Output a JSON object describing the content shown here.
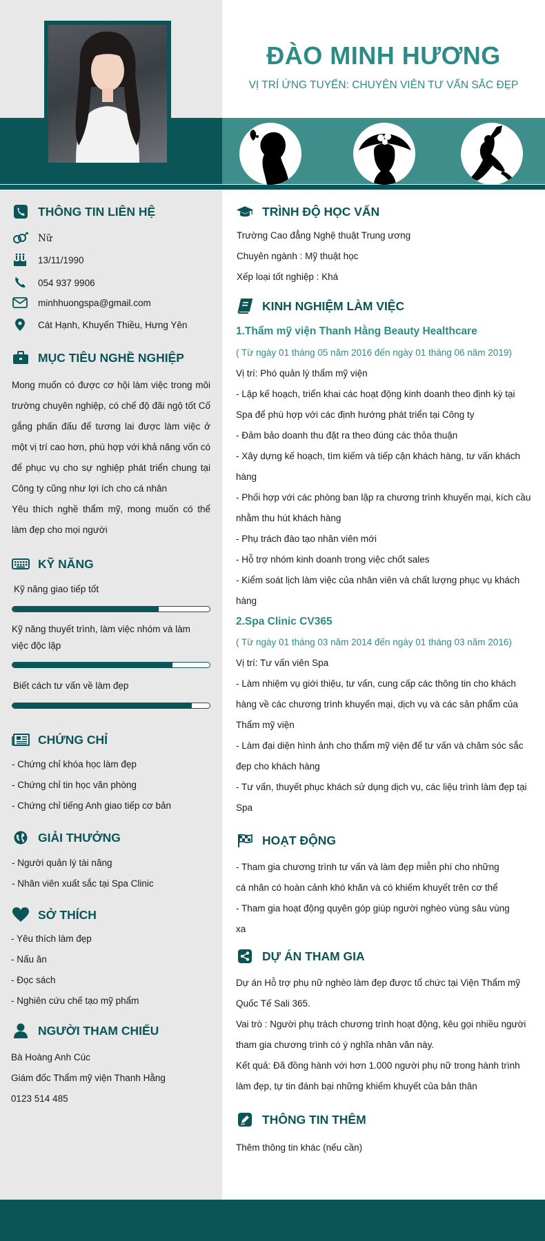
{
  "header": {
    "name": "ĐÀO MINH HƯƠNG",
    "position": "VỊ TRÍ ỨNG TUYỂN: CHUYÊN VIÊN TƯ VẤN SẮC ĐẸP"
  },
  "colors": {
    "primary": "#0b5457",
    "accent": "#2d8b87",
    "band": "#3e8f8c",
    "sidebar": "#e8e8e8"
  },
  "contact": {
    "title": "THÔNG TIN LIÊN HỆ",
    "gender": "Nữ",
    "birthday": "13/11/1990",
    "phone": "054 937 9906",
    "email": "minhhuongspa@gmail.com",
    "address": "Cát Hạnh, Khuyến Thiều, Hưng Yên"
  },
  "objective": {
    "title": "MỤC TIÊU NGHỀ NGHIỆP",
    "text1": "Mong muốn có được cơ hội làm việc trong môi trường chuyên nghiệp, có chế độ đãi ngộ tốt Cố gắng phấn đấu để tương lai được làm việc ở một vị trí cao hơn, phù hợp với khả năng vốn có để phục vụ cho sự nghiệp phát triển chung tại Công ty cũng như lợi ích cho cá nhân",
    "text2": "Yêu thích nghề thẩm mỹ, mong muốn có thể làm đẹp cho mọi người"
  },
  "skills": {
    "title": "KỸ NĂNG",
    "items": [
      {
        "label": "Kỹ năng giao tiếp tốt",
        "level": 0.74
      },
      {
        "label": "Kỹ năng thuyết trình, làm việc nhóm và làm việc độc lập",
        "level": 0.81
      },
      {
        "label": "Biết cách tư vấn về làm đẹp",
        "level": 0.91
      }
    ]
  },
  "certificates": {
    "title": "CHỨNG CHỈ",
    "items": [
      "- Chứng chỉ khóa học làm đẹp",
      "- Chứng chỉ tin học văn phòng",
      "- Chứng chỉ tiếng Anh giao tiếp cơ bản"
    ]
  },
  "awards": {
    "title": "GIẢI THƯỞNG",
    "items": [
      "- Người quản lý tài năng",
      "- Nhân viên xuất sắc tại Spa Clinic"
    ]
  },
  "hobbies": {
    "title": "SỞ THÍCH",
    "items": [
      "- Yêu thích làm đẹp",
      "- Nấu ăn",
      "- Đọc sách",
      "- Nghiên cứu chế tạo mỹ phẩm"
    ]
  },
  "references": {
    "title": "NGƯỜI THAM CHIẾU",
    "items": [
      "Bà Hoàng Anh Cúc",
      "Giám đốc Thẩm mỹ viện Thanh Hằng",
      "0123 514 485"
    ]
  },
  "education": {
    "title": "TRÌNH ĐỘ HỌC VẤN",
    "items": [
      "Trường Cao đẳng Nghệ thuật Trung ương",
      "Chuyên ngành : Mỹ thuật học",
      "Xếp loại tốt nghiệp : Khá"
    ]
  },
  "experience": {
    "title": "KINH NGHIỆM LÀM VIỆC",
    "jobs": [
      {
        "company": "1.Thẩm mỹ viện Thanh Hằng Beauty Healthcare",
        "date": "( Từ ngày 01 tháng 05 năm 2016  đến ngày 01 tháng 06 năm 2019)",
        "role": "Vị trí: Phó quản lý thẩm mỹ viện",
        "duties": [
          "- Lập kế hoạch, triển khai các hoạt động kinh doanh theo định kỳ tại Spa để phù hợp với các định hướng phát triển tại Công ty",
          "- Đảm bảo doanh thu đặt ra theo đúng các thỏa thuận",
          "- Xây dựng kế hoạch, tìm kiếm và tiếp cận khách hàng, tư vấn khách hàng",
          "- Phối hợp với các phòng ban lập ra chương trình khuyến mại, kích cầu nhằm thu hút khách hàng",
          "- Phụ trách đào tạo nhân viên mới",
          "- Hỗ trợ nhóm kinh doanh trong việc chốt sales",
          "- Kiểm soát lịch làm việc của nhân viên và chất lượng phục vụ khách hàng"
        ]
      },
      {
        "company": "2.Spa Clinic CV365",
        "date": "( Từ ngày 01 tháng 03 năm 2014 đến ngày 01 tháng 03 năm 2016)",
        "role": "Vị trí: Tư vấn viên Spa",
        "duties": [
          "- Làm nhiệm vụ giới thiệu, tư vấn, cung cấp các thông tin cho khách hàng về các chương trình khuyến mại, dịch vụ và các sản phẩm của Thẩm mỹ viện",
          "- Làm đại diện hình ảnh cho thẩm mỹ viện để tư vấn và chăm sóc sắc đẹp cho khách hàng",
          "- Tư vấn, thuyết phục khách sử dụng dịch vụ, các liệu trình làm đẹp tại Spa"
        ]
      }
    ]
  },
  "activities": {
    "title": "HOẠT ĐỘNG",
    "lines": [
      "- Tham gia chương trình tư vấn và làm đẹp miễn phí cho những",
      "cá nhân có hoàn cảnh khó khăn và có khiếm khuyết trên cơ thể",
      "- Tham gia hoạt động quyên góp giúp người nghèo vùng sâu vùng",
      "xa"
    ]
  },
  "projects": {
    "title": "DỰ ÁN THAM GIA",
    "items": [
      "Dự án Hỗ trợ phụ nữ nghèo làm đẹp được tổ chức tại Viện Thẩm mỹ Quốc Tế Sali 365.",
      "Vai trò : Người phụ trách chương trình hoạt động, kêu gọi nhiều người tham gia chương trình có ý nghĩa nhân văn này.",
      "Kết quả: Đã đồng hành với hơn 1.000 người phụ nữ trong hành trình làm đẹp, tự tin đánh bại những khiếm khuyết của bản thân"
    ]
  },
  "extra": {
    "title": "THÔNG TIN THÊM",
    "text": "Thêm thông tin khác (nếu cần)"
  }
}
